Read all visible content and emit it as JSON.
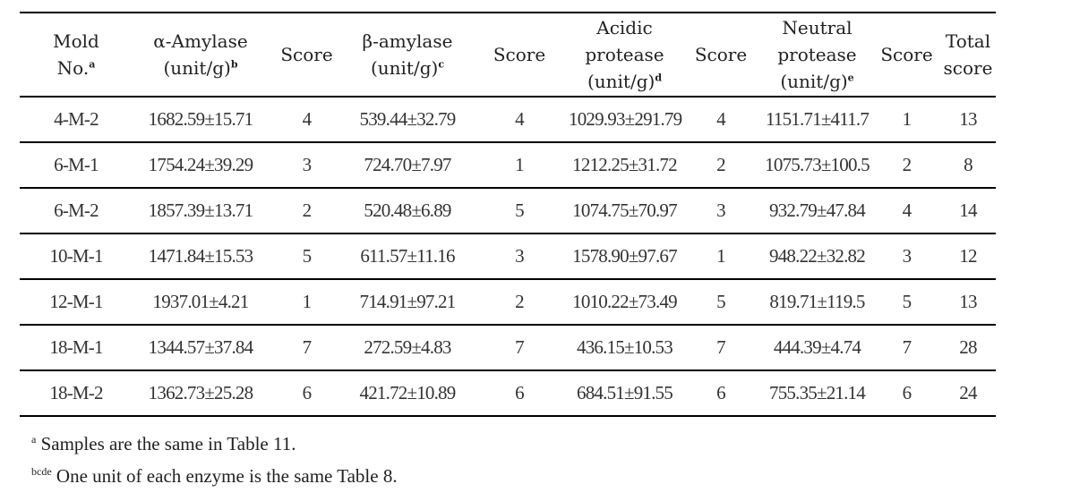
{
  "table": {
    "headers": [
      {
        "lines": [
          "Mold",
          "No."
        ],
        "sup": "a"
      },
      {
        "lines": [
          "α-Amylase",
          "(unit/g)"
        ],
        "sup": "b"
      },
      {
        "lines": [
          "Score"
        ],
        "sup": ""
      },
      {
        "lines": [
          "β-amylase",
          "(unit/g)"
        ],
        "sup": "c"
      },
      {
        "lines": [
          "Score"
        ],
        "sup": ""
      },
      {
        "lines": [
          "Acidic",
          "protease",
          "(unit/g)"
        ],
        "sup": "d"
      },
      {
        "lines": [
          "Score"
        ],
        "sup": ""
      },
      {
        "lines": [
          "Neutral",
          "protease",
          "(unit/g)"
        ],
        "sup": "e"
      },
      {
        "lines": [
          "Score"
        ],
        "sup": ""
      },
      {
        "lines": [
          "Total",
          "score"
        ],
        "sup": ""
      }
    ],
    "rows": [
      [
        "4-M-2",
        "1682.59±15.71",
        "4",
        "539.44±32.79",
        "4",
        "1029.93±291.79",
        "4",
        "1151.71±411.7",
        "1",
        "13"
      ],
      [
        "6-M-1",
        "1754.24±39.29",
        "3",
        "724.70±7.97",
        "1",
        "1212.25±31.72",
        "2",
        "1075.73±100.5",
        "2",
        "8"
      ],
      [
        "6-M-2",
        "1857.39±13.71",
        "2",
        "520.48±6.89",
        "5",
        "1074.75±70.97",
        "3",
        "932.79±47.84",
        "4",
        "14"
      ],
      [
        "10-M-1",
        "1471.84±15.53",
        "5",
        "611.57±11.16",
        "3",
        "1578.90±97.67",
        "1",
        "948.22±32.82",
        "3",
        "12"
      ],
      [
        "12-M-1",
        "1937.01±4.21",
        "1",
        "714.91±97.21",
        "2",
        "1010.22±73.49",
        "5",
        "819.71±119.5",
        "5",
        "13"
      ],
      [
        "18-M-1",
        "1344.57±37.84",
        "7",
        "272.59±4.83",
        "7",
        "436.15±10.53",
        "7",
        "444.39±4.74",
        "7",
        "28"
      ],
      [
        "18-M-2",
        "1362.73±25.28",
        "6",
        "421.72±10.89",
        "6",
        "684.51±91.55",
        "6",
        "755.35±21.14",
        "6",
        "24"
      ]
    ]
  },
  "footnotes": [
    {
      "mark": "a",
      "text": "Samples are the same in Table 11."
    },
    {
      "mark": "bcde",
      "text": "One unit of each enzyme is the same Table 8."
    }
  ]
}
